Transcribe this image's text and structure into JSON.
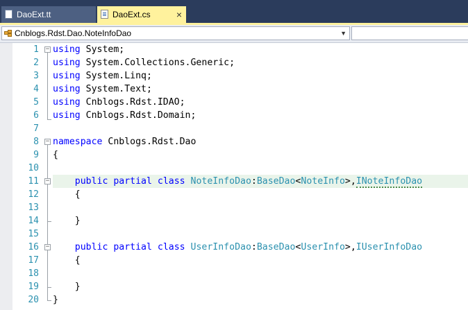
{
  "tabs": [
    {
      "label": "DaoExt.tt",
      "active": false
    },
    {
      "label": "DaoExt.cs",
      "active": true,
      "close": "×"
    }
  ],
  "navbar": {
    "type_combo": "Cnblogs.Rdst.Dao.NoteInfoDao",
    "arrow": "▼"
  },
  "line_numbers": [
    "1",
    "2",
    "3",
    "4",
    "5",
    "6",
    "7",
    "8",
    "9",
    "10",
    "11",
    "12",
    "13",
    "14",
    "15",
    "16",
    "17",
    "18",
    "19",
    "20"
  ],
  "code": {
    "l1": {
      "kw": "using",
      "rest": " System;"
    },
    "l2": {
      "kw": "using",
      "rest": " System.Collections.Generic;"
    },
    "l3": {
      "kw": "using",
      "rest": " System.Linq;"
    },
    "l4": {
      "kw": "using",
      "rest": " System.Text;"
    },
    "l5": {
      "kw": "using",
      "rest": " Cnblogs.Rdst.IDAO;"
    },
    "l6": {
      "kw": "using",
      "rest": " Cnblogs.Rdst.Domain;"
    },
    "l8": {
      "kw": "namespace",
      "rest": " Cnblogs.Rdst.Dao"
    },
    "l9": {
      "text": "{"
    },
    "l11": {
      "indent": "    ",
      "kw1": "public",
      "kw2": "partial",
      "kw3": "class",
      "name": "NoteInfoDao",
      "colon": ":",
      "base": "BaseDao",
      "lt": "<",
      "arg": "NoteInfo",
      "gt": ">,",
      "iface": "INoteInfoDao"
    },
    "l12": {
      "text": "    {"
    },
    "l14": {
      "text": "    }"
    },
    "l16": {
      "indent": "    ",
      "kw1": "public",
      "kw2": "partial",
      "kw3": "class",
      "name": "UserInfoDao",
      "colon": ":",
      "base": "BaseDao",
      "lt": "<",
      "arg": "UserInfo",
      "gt": ">,",
      "iface": "IUserInfoDao"
    },
    "l17": {
      "text": "    {"
    },
    "l19": {
      "text": "    }"
    },
    "l20": {
      "text": "}"
    }
  },
  "outline": {
    "minus": "−"
  },
  "colors": {
    "keyword": "#0000ff",
    "type": "#2b91af",
    "line_number": "#2b91af",
    "active_tab": "#fff29d",
    "frame": "#2b3c5c"
  }
}
